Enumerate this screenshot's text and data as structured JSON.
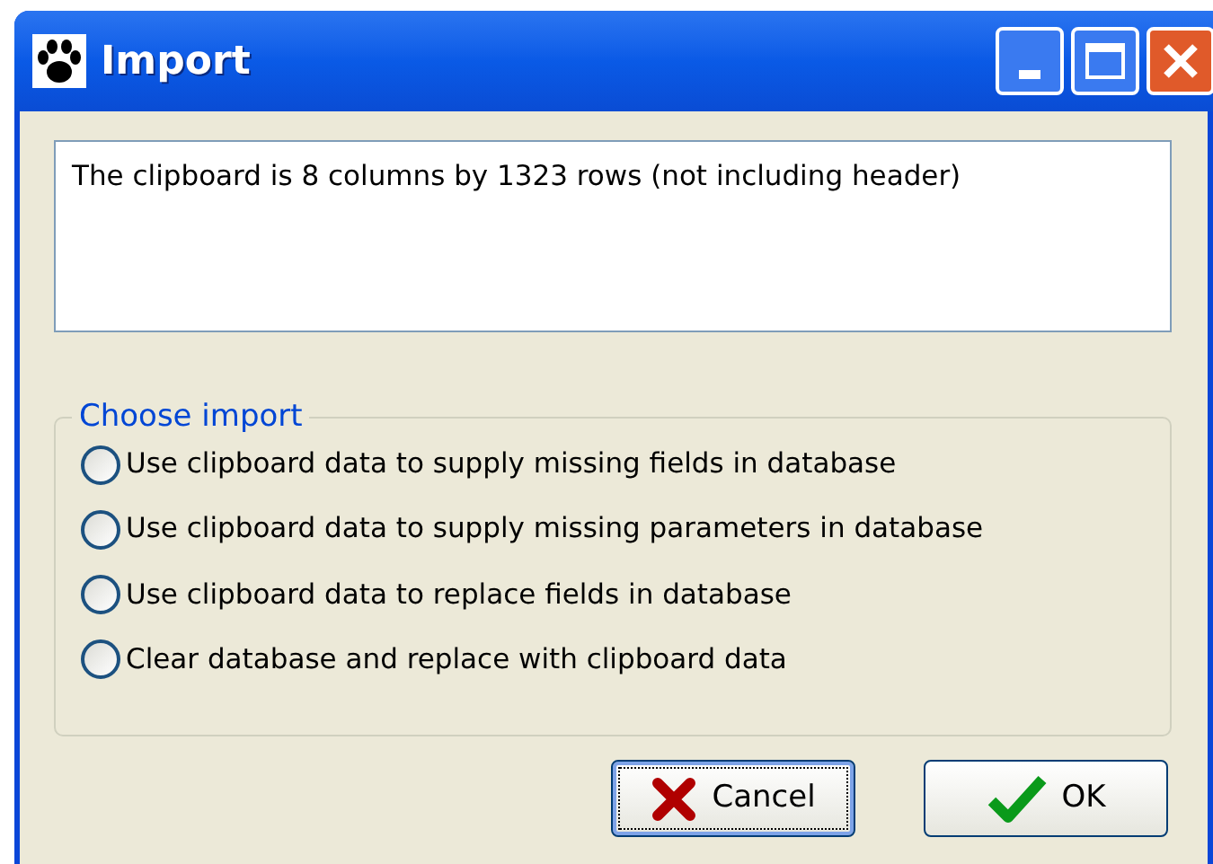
{
  "window": {
    "title": "Import"
  },
  "message": "The clipboard is 8 columns by 1323 rows (not including header)",
  "import_group": {
    "title": "Choose import",
    "options": [
      {
        "label": "Use clipboard data to supply missing fields in database",
        "selected": false
      },
      {
        "label": "Use clipboard data to supply missing parameters in database",
        "selected": false
      },
      {
        "label": "Use clipboard data to replace fields in database",
        "selected": false
      },
      {
        "label": "Clear database and replace with clipboard data",
        "selected": false
      }
    ]
  },
  "buttons": [
    {
      "label": "Cancel",
      "kind": "cancel",
      "focused": true
    },
    {
      "label": "OK",
      "kind": "ok",
      "focused": false
    }
  ]
}
